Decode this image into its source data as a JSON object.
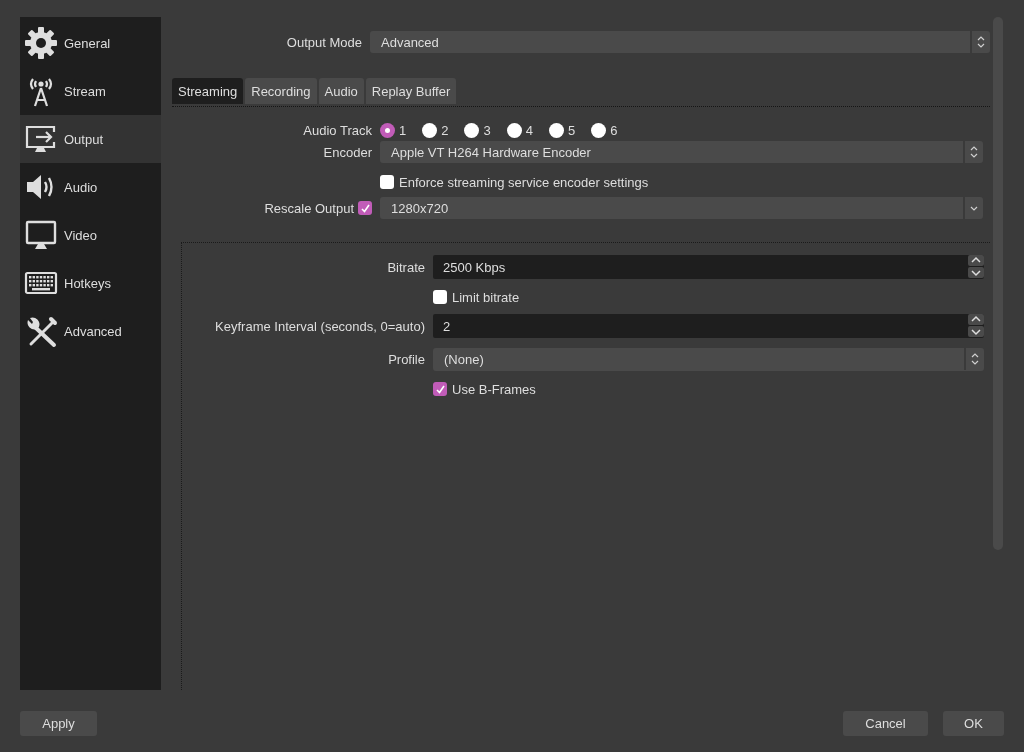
{
  "sidebar": {
    "items": [
      {
        "label": "General",
        "selected": false
      },
      {
        "label": "Stream",
        "selected": false
      },
      {
        "label": "Output",
        "selected": true
      },
      {
        "label": "Audio",
        "selected": false
      },
      {
        "label": "Video",
        "selected": false
      },
      {
        "label": "Hotkeys",
        "selected": false
      },
      {
        "label": "Advanced",
        "selected": false
      }
    ]
  },
  "output_mode": {
    "label": "Output Mode",
    "value": "Advanced"
  },
  "tabs": [
    {
      "label": "Streaming",
      "selected": true
    },
    {
      "label": "Recording",
      "selected": false
    },
    {
      "label": "Audio",
      "selected": false
    },
    {
      "label": "Replay Buffer",
      "selected": false
    }
  ],
  "streaming": {
    "audio_track": {
      "label": "Audio Track",
      "options": [
        {
          "label": "1",
          "selected": true
        },
        {
          "label": "2",
          "selected": false
        },
        {
          "label": "3",
          "selected": false
        },
        {
          "label": "4",
          "selected": false
        },
        {
          "label": "5",
          "selected": false
        },
        {
          "label": "6",
          "selected": false
        }
      ]
    },
    "encoder": {
      "label": "Encoder",
      "value": "Apple VT H264 Hardware Encoder"
    },
    "enforce": {
      "label": "Enforce streaming service encoder settings",
      "checked": false
    },
    "rescale": {
      "label": "Rescale Output",
      "checked": true,
      "value": "1280x720"
    },
    "encoder_settings": {
      "bitrate": {
        "label": "Bitrate",
        "value": "2500 Kbps"
      },
      "limit_bitrate": {
        "label": "Limit bitrate",
        "checked": false
      },
      "keyframe_interval": {
        "label": "Keyframe Interval (seconds, 0=auto)",
        "value": "2"
      },
      "profile": {
        "label": "Profile",
        "value": "(None)"
      },
      "b_frames": {
        "label": "Use B-Frames",
        "checked": true
      }
    }
  },
  "buttons": {
    "apply": "Apply",
    "cancel": "Cancel",
    "ok": "OK"
  }
}
